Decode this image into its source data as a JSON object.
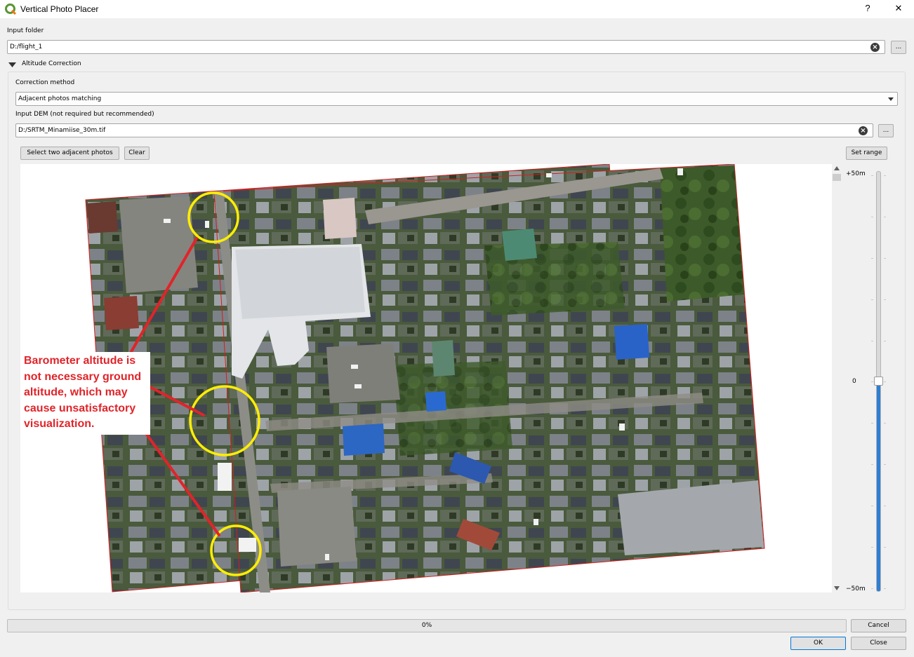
{
  "window": {
    "title": "Vertical Photo Placer",
    "help_label": "?",
    "close_label": "✕"
  },
  "input_folder": {
    "label": "Input folder",
    "value": "D:/flight_1",
    "browse_label": "..."
  },
  "altitude_correction": {
    "group_label": "Altitude Correction",
    "method_label": "Correction method",
    "method_value": "Adjacent photos matching",
    "dem_label": "Input DEM (not required but recommended)",
    "dem_value": "D:/SRTM_Minamiise_30m.tif",
    "dem_browse_label": "...",
    "select_photos_label": "Select two adjacent photos",
    "clear_label": "Clear",
    "set_range_label": "Set range"
  },
  "slider": {
    "max_label": "+50m",
    "mid_label": "0",
    "min_label": "−50m",
    "value_fraction": 0.5
  },
  "annotation": {
    "text": "Barometer altitude is not necessary ground altitude, which may cause unsatisfactory visualization.",
    "text_color": "#e0242a",
    "circle_color": "#ffee00",
    "line_color": "#e0242a"
  },
  "footer": {
    "progress_text": "0%",
    "progress_value": 0,
    "cancel_label": "Cancel",
    "ok_label": "OK",
    "close_label": "Close"
  },
  "colors": {
    "accent": "#2d7fd4",
    "photo_border": "#d41e1e"
  },
  "icons": {
    "app": "qgis-icon",
    "clear": "clear-circle-icon",
    "expand": "triangle-down-icon"
  }
}
